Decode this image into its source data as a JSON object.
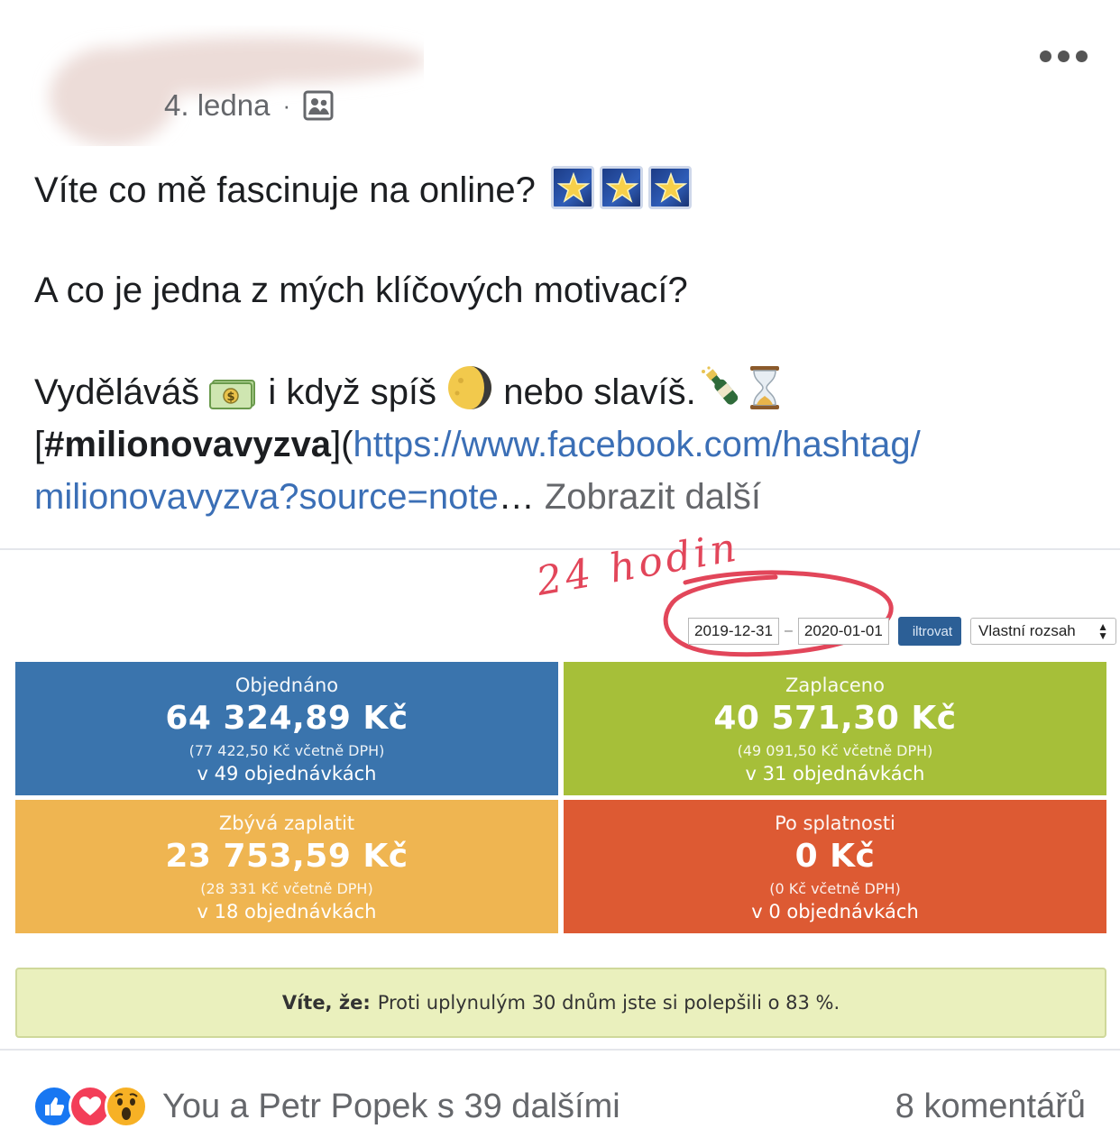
{
  "post": {
    "date": "4. ledna",
    "separator": "·",
    "audience_icon": "group-icon",
    "lines": {
      "line1": "Víte co mě fascinuje na online?",
      "line2": "A co je jedna z mých klíčových motivací?",
      "line3_a": "Vyděláváš",
      "line3_b": "i když spíš",
      "line3_c": "nebo slavíš.",
      "hashtag_open": "[",
      "hashtag": "#milionovavyzva",
      "hashtag_close": "](",
      "link1": "https://www.facebook.com/hashtag/",
      "link2": "milionovavyzva?source=note",
      "ellipsis": "…",
      "see_more": "Zobrazit další"
    }
  },
  "screenshot": {
    "annotation": "24 hodin",
    "date_from": "2019-12-31",
    "date_dash": "–",
    "date_to": "2020-01-01",
    "filter_label": "iltrovat",
    "range_label": "Vlastní rozsah",
    "tiles": [
      {
        "label": "Objednáno",
        "value": "64 324,89 Kč",
        "vat": "(77 422,50 Kč včetně DPH)",
        "count": "v 49 objednávkách",
        "color": "#3a74ad"
      },
      {
        "label": "Zaplaceno",
        "value": "40 571,30 Kč",
        "vat": "(49 091,50 Kč včetně DPH)",
        "count": "v 31 objednávkách",
        "color": "#a6bf39"
      },
      {
        "label": "Zbývá zaplatit",
        "value": "23 753,59 Kč",
        "vat": "(28 331 Kč včetně DPH)",
        "count": "v 18 objednávkách",
        "color": "#efb551"
      },
      {
        "label": "Po splatnosti",
        "value": "0 Kč",
        "vat": "(0 Kč včetně DPH)",
        "count": "v 0 objednávkách",
        "color": "#dd5a33"
      }
    ],
    "info_bold": "Víte, že:",
    "info_text": "Proti uplynulým 30 dnům jste si polepšili o 83 %."
  },
  "footer": {
    "reactions_text": "You a Petr Popek s 39 dalšími",
    "comments": "8 komentářů"
  }
}
